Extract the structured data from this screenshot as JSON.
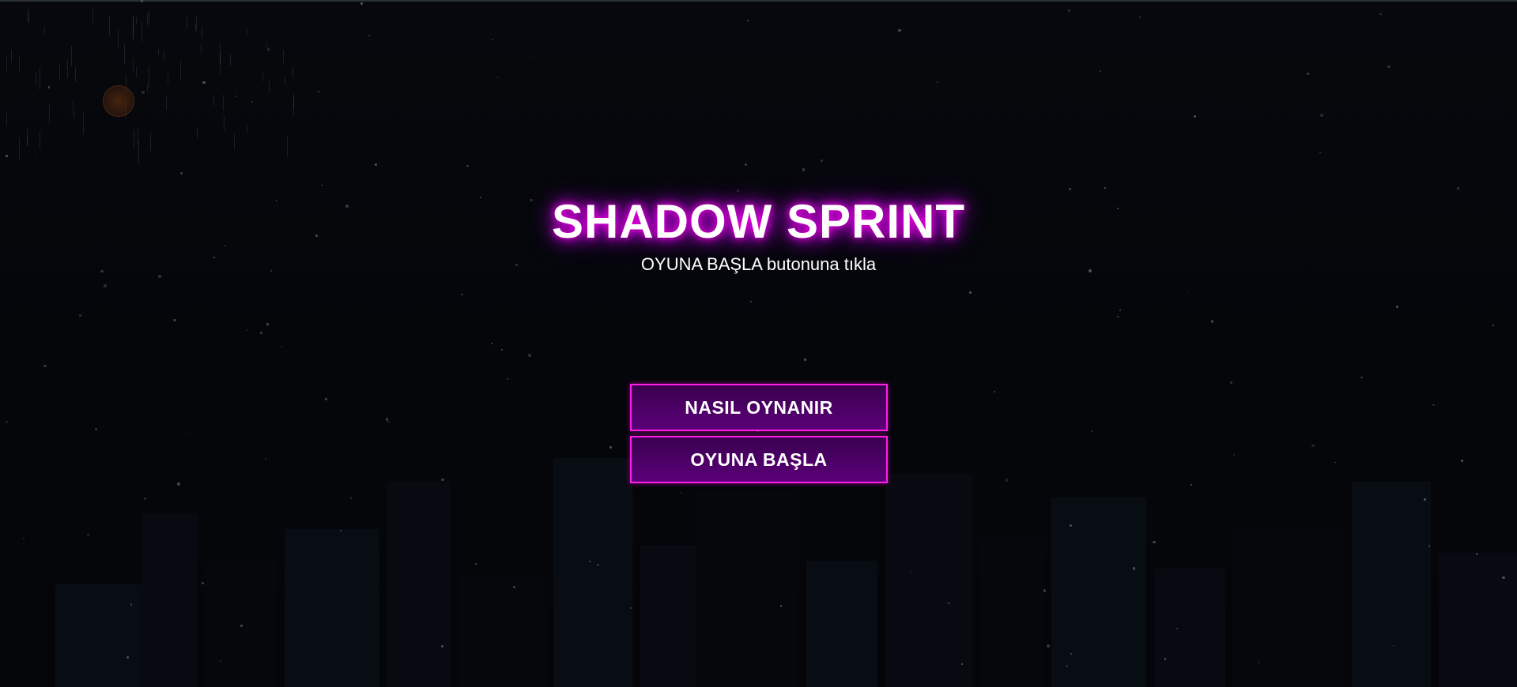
{
  "game": {
    "title": "SHADOW SPRINT",
    "subtitle": "OYUNA BAŞLA butonuna tıkla"
  },
  "menu": {
    "how_to_play_label": "NASIL OYNANIR",
    "start_label": "OYUNA BAŞLA"
  },
  "colors": {
    "background": "#05070c",
    "neon_accent": "#ff1ee6",
    "button_fill": "#4a0066",
    "moon": "#8a3a10"
  }
}
